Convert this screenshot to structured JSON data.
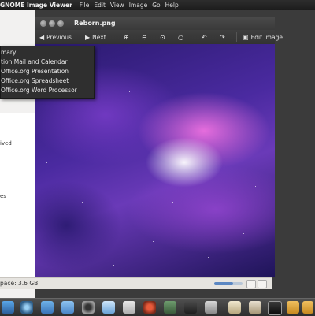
{
  "top_panel": {
    "app_name": "GNOME Image Viewer",
    "menus": [
      "File",
      "Edit",
      "View",
      "Image",
      "Go",
      "Help"
    ]
  },
  "file_manager": {
    "sidebar_fragments": [
      "ived",
      "es"
    ],
    "status_text": "pace: 3.6 GB"
  },
  "popup_menu": {
    "items": [
      "mary",
      "tion Mail and Calendar",
      "Office.org Presentation",
      "Office.org Spreadsheet",
      "Office.org Word Processor"
    ]
  },
  "viewer": {
    "title": "Reborn.png",
    "toolbar": {
      "previous": "Previous",
      "next": "Next",
      "edit_image": "Edit Image"
    }
  },
  "dock": {
    "icons": [
      "browser-icon",
      "eye-icon",
      "folder-icon",
      "finder-icon",
      "webcam-icon",
      "droplet-icon",
      "package-icon",
      "media-icon",
      "display-icon",
      "chess-icon",
      "suit-icon",
      "calculator-icon",
      "terminal-icon",
      "folder-icon",
      "folder-icon"
    ]
  }
}
